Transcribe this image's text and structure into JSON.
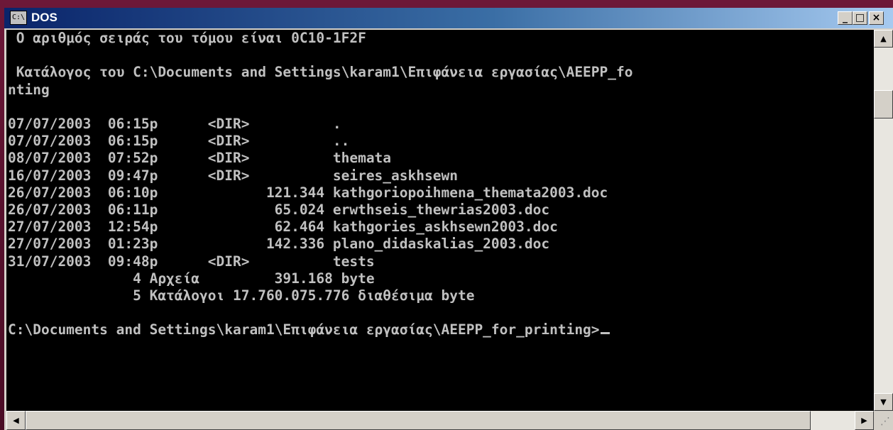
{
  "window": {
    "title": "DOS",
    "icon_label": "C:\\",
    "minimize_glyph": "_",
    "maximize_glyph": "□",
    "close_glyph": "×"
  },
  "console": {
    "lines": [
      " Ο αριθμός σειράς του τόμου είναι 0C10-1F2F",
      "",
      " Κατάλογος του C:\\Documents and Settings\\karam1\\Επιφάνεια εργασίας\\AEEPP_fo",
      "nting",
      "",
      "07/07/2003  06:15p      <DIR>          .",
      "07/07/2003  06:15p      <DIR>          ..",
      "08/07/2003  07:52p      <DIR>          themata",
      "16/07/2003  09:47p      <DIR>          seires_askhsewn",
      "26/07/2003  06:10p             121.344 kathgoriopoihmena_themata2003.doc",
      "26/07/2003  06:11p              65.024 erwthseis_thewrias2003.doc",
      "27/07/2003  12:54p              62.464 kathgories_askhsewn2003.doc",
      "27/07/2003  01:23p             142.336 plano_didaskalias_2003.doc",
      "31/07/2003  09:48p      <DIR>          tests",
      "               4 Αρχεία         391.168 byte",
      "               5 Κατάλογοι 17.760.075.776 διαθέσιμα byte",
      ""
    ],
    "prompt": "C:\\Documents and Settings\\karam1\\Επιφάνεια εργασίας\\AEEPP_for_printing>"
  },
  "scrollbars": {
    "up_glyph": "▲",
    "down_glyph": "▼",
    "left_glyph": "◀",
    "right_glyph": "▶",
    "grip_glyph": "⋰"
  },
  "colors": {
    "console_bg": "#000000",
    "console_fg": "#c0c0c0",
    "titlebar_start": "#0a246a",
    "titlebar_end": "#a6caf0"
  }
}
